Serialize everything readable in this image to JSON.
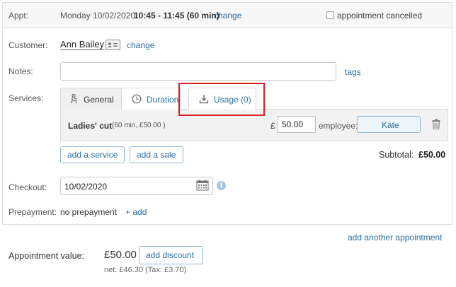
{
  "appointment": {
    "label": "Appt:",
    "date": "Monday 10/02/2020",
    "time": "10:45 - 11:45 (60 min)",
    "change_label": "change",
    "cancelled_label": "appointment cancelled",
    "cancelled_checked": false
  },
  "customer": {
    "label": "Customer:",
    "name": "Ann Bailey",
    "change_label": "change"
  },
  "notes": {
    "label": "Notes:",
    "value": "",
    "tags_label": "tags"
  },
  "services": {
    "label": "Services:",
    "tabs": [
      {
        "label": "General",
        "icon": "person-chair-icon"
      },
      {
        "label": "Duration",
        "icon": "clock-icon"
      },
      {
        "label": "Usage (0)",
        "icon": "download-icon"
      }
    ],
    "item": {
      "name": "Ladies' cut",
      "meta": "(60 min, £50.00 )",
      "currency": "£",
      "price": "50.00",
      "employee_label": "employee:",
      "employee": "Kate"
    },
    "add_service_label": "add a service",
    "add_sale_label": "add a sale",
    "subtotal_label": "Subtotal:",
    "subtotal_value": "£50.00"
  },
  "checkout": {
    "label": "Checkout:",
    "value": "10/02/2020",
    "info_glyph": "i"
  },
  "prepayment": {
    "label": "Prepayment:",
    "value": "no prepayment",
    "add_label": "+ add"
  },
  "footer": {
    "add_another_label": "add another appointment",
    "value_label": "Appointment value:",
    "value_amount": "£50.00",
    "add_discount_label": "add discount",
    "net_text": "net: £46.30 (Tax: £3.70)"
  },
  "colors": {
    "link": "#2a6fa8",
    "highlight": "#d9211f"
  }
}
